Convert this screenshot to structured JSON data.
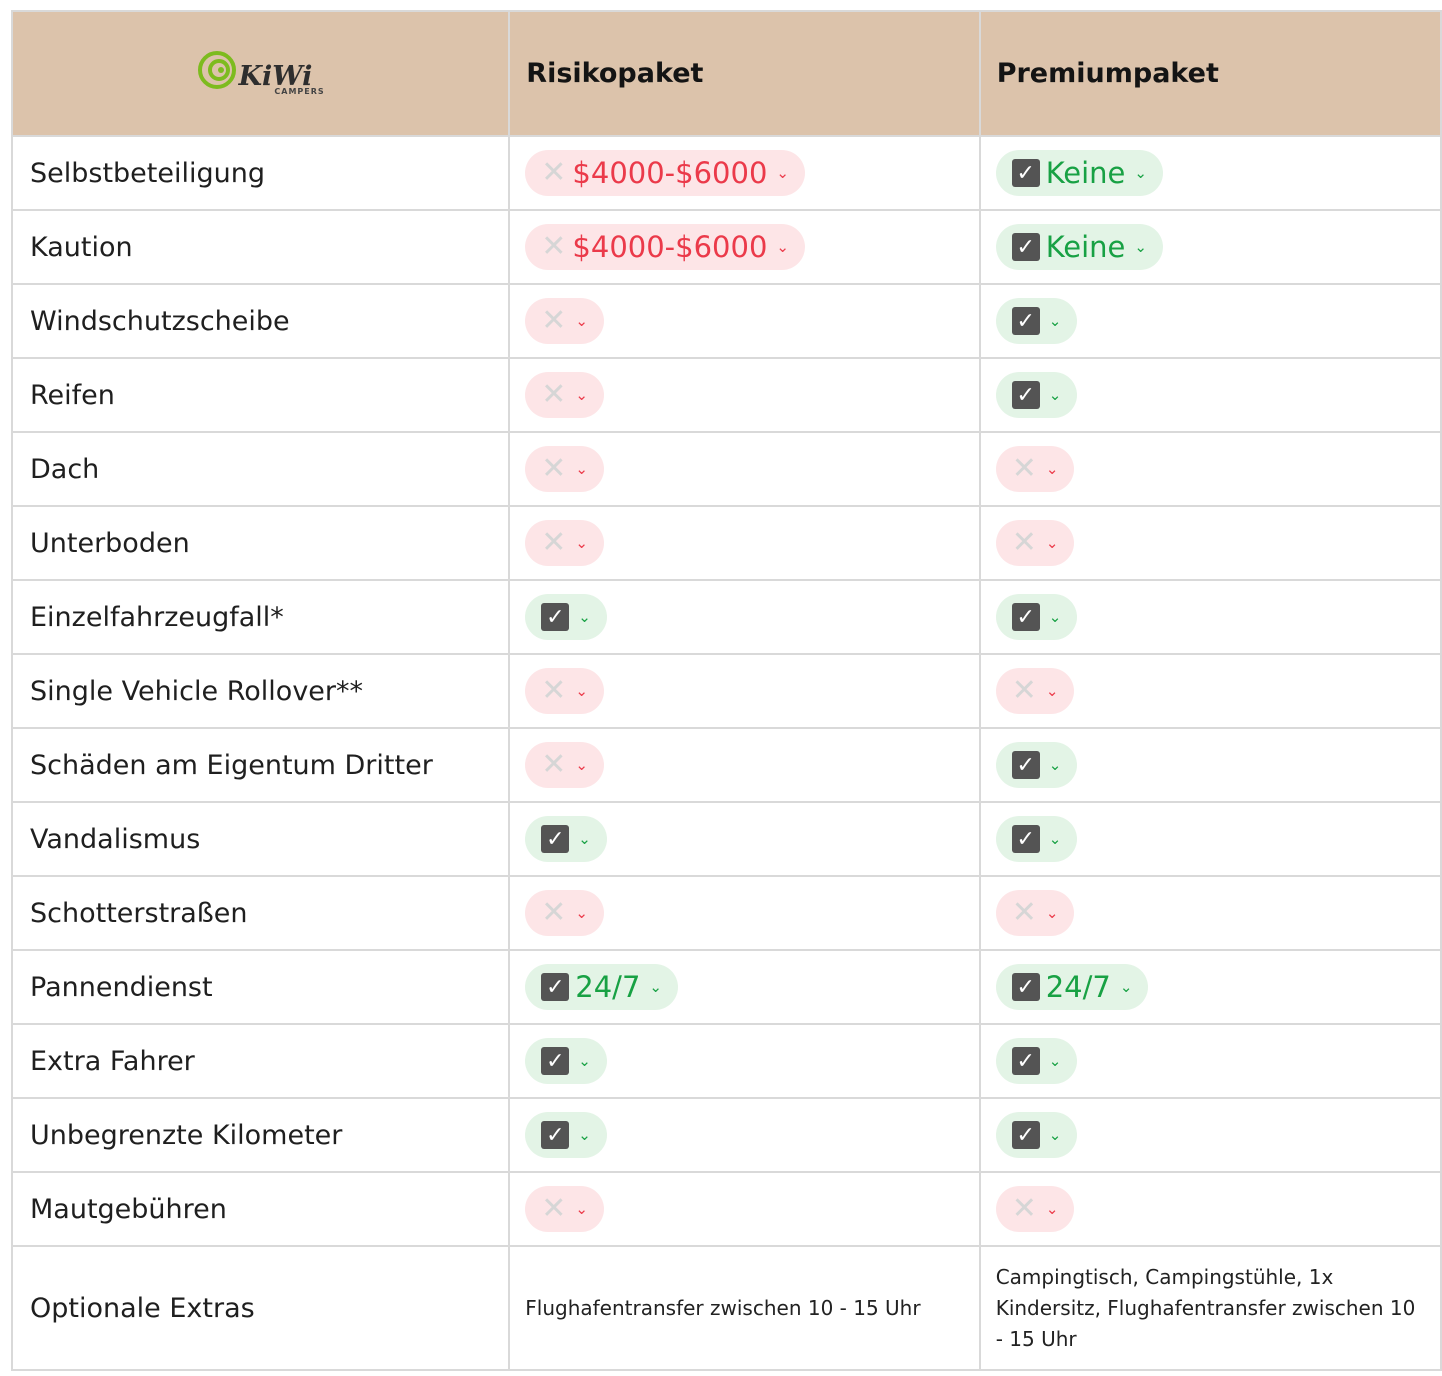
{
  "brand": {
    "logo_word": "KiWi",
    "logo_sub": "CAMPERS",
    "green": "#7dbb1f"
  },
  "columns": [
    "Risikopaket",
    "Premiumpaket"
  ],
  "colors": {
    "header_bg": "#dcc3ab",
    "no_bg": "#fde5e7",
    "no_text": "#eb3a4a",
    "yes_bg": "#e3f4e6",
    "yes_text": "#18a144",
    "check_box": "#545454"
  },
  "rows": [
    {
      "label": "Selbstbeteiligung",
      "risiko": {
        "status": "no",
        "value": "$4000-$6000"
      },
      "premium": {
        "status": "yes",
        "value": "Keine"
      }
    },
    {
      "label": "Kaution",
      "risiko": {
        "status": "no",
        "value": "$4000-$6000"
      },
      "premium": {
        "status": "yes",
        "value": "Keine"
      }
    },
    {
      "label": "Windschutzscheibe",
      "risiko": {
        "status": "no",
        "value": ""
      },
      "premium": {
        "status": "yes",
        "value": ""
      }
    },
    {
      "label": "Reifen",
      "risiko": {
        "status": "no",
        "value": ""
      },
      "premium": {
        "status": "yes",
        "value": ""
      }
    },
    {
      "label": "Dach",
      "risiko": {
        "status": "no",
        "value": ""
      },
      "premium": {
        "status": "no",
        "value": ""
      }
    },
    {
      "label": "Unterboden",
      "risiko": {
        "status": "no",
        "value": ""
      },
      "premium": {
        "status": "no",
        "value": ""
      }
    },
    {
      "label": "Einzelfahrzeugfall*",
      "risiko": {
        "status": "yes",
        "value": ""
      },
      "premium": {
        "status": "yes",
        "value": ""
      }
    },
    {
      "label": "Single Vehicle Rollover**",
      "risiko": {
        "status": "no",
        "value": ""
      },
      "premium": {
        "status": "no",
        "value": ""
      }
    },
    {
      "label": "Schäden am Eigentum Dritter",
      "risiko": {
        "status": "no",
        "value": ""
      },
      "premium": {
        "status": "yes",
        "value": ""
      }
    },
    {
      "label": "Vandalismus",
      "risiko": {
        "status": "yes",
        "value": ""
      },
      "premium": {
        "status": "yes",
        "value": ""
      }
    },
    {
      "label": "Schotterstraßen",
      "risiko": {
        "status": "no",
        "value": ""
      },
      "premium": {
        "status": "no",
        "value": ""
      }
    },
    {
      "label": "Pannendienst",
      "risiko": {
        "status": "yes",
        "value": "24/7"
      },
      "premium": {
        "status": "yes",
        "value": "24/7"
      }
    },
    {
      "label": "Extra Fahrer",
      "risiko": {
        "status": "yes",
        "value": ""
      },
      "premium": {
        "status": "yes",
        "value": ""
      }
    },
    {
      "label": "Unbegrenzte Kilometer",
      "risiko": {
        "status": "yes",
        "value": ""
      },
      "premium": {
        "status": "yes",
        "value": ""
      }
    },
    {
      "label": "Mautgebühren",
      "risiko": {
        "status": "no",
        "value": ""
      },
      "premium": {
        "status": "no",
        "value": ""
      }
    }
  ],
  "extras": {
    "label": "Optionale Extras",
    "risiko": "Flughafentransfer zwischen 10 - 15 Uhr",
    "premium": "Campingtisch, Campingstühle, 1x Kindersitz, Flughafentransfer zwischen 10 - 15 Uhr"
  },
  "icons": {
    "no": "x-icon",
    "yes": "check-icon",
    "dropdown": "chevron-down-icon"
  }
}
